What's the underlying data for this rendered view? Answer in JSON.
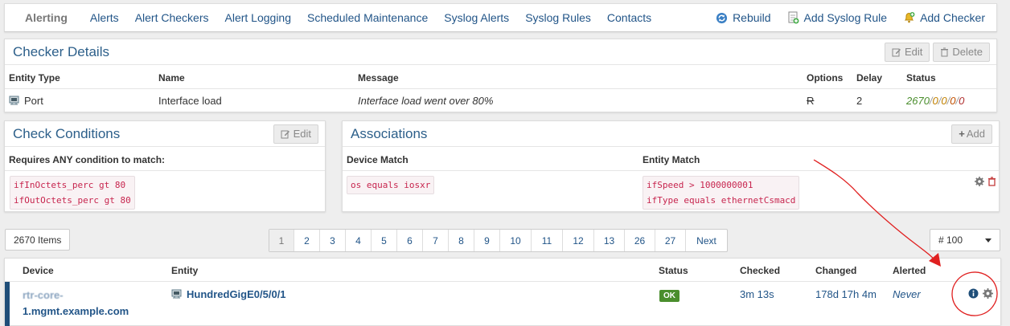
{
  "nav": {
    "brand": "Alerting",
    "links": [
      "Alerts",
      "Alert Checkers",
      "Alert Logging",
      "Scheduled Maintenance",
      "Syslog Alerts",
      "Syslog Rules",
      "Contacts"
    ],
    "actions": [
      "Rebuild",
      "Add Syslog Rule",
      "Add Checker"
    ]
  },
  "checker": {
    "title": "Checker Details",
    "edit_label": "Edit",
    "delete_label": "Delete",
    "headers": [
      "Entity Type",
      "Name",
      "Message",
      "Options",
      "Delay",
      "Status"
    ],
    "row": {
      "entity_type": "Port",
      "name": "Interface load",
      "message": "Interface load went over 80%",
      "options": "R",
      "delay": "2",
      "status_ok": "2670",
      "status_rest": [
        "0",
        "0",
        "0",
        "0"
      ]
    }
  },
  "conditions": {
    "title": "Check Conditions",
    "edit_label": "Edit",
    "requires_label": "Requires ANY condition to match:",
    "items": [
      "ifInOctets_perc gt 80",
      "ifOutOctets_perc gt 80"
    ]
  },
  "associations": {
    "title": "Associations",
    "add_label": "Add",
    "device_match_header": "Device Match",
    "entity_match_header": "Entity Match",
    "device_match": [
      "os equals iosxr"
    ],
    "entity_match": [
      "ifSpeed > 1000000001",
      "ifType equals ethernetCsmacd"
    ]
  },
  "pagination": {
    "items_label": "2670 Items",
    "pages": [
      "1",
      "2",
      "3",
      "4",
      "5",
      "6",
      "7",
      "8",
      "9",
      "10",
      "11",
      "12",
      "13",
      "26",
      "27",
      "Next"
    ],
    "active": "1",
    "per_page": "# 100"
  },
  "entities": {
    "headers": [
      "Device",
      "Entity",
      "Status",
      "Checked",
      "Changed",
      "Alerted"
    ],
    "row": {
      "device_line1": "rtr-core-",
      "device_line2": "1.mgmt.example.com",
      "entity": "HundredGigE0/5/0/1",
      "status": "OK",
      "checked": "3m 13s",
      "changed": "178d 17h 4m",
      "alerted": "Never"
    }
  },
  "colors": {
    "link": "#225588",
    "title": "#2c5f8a",
    "ok": "#4a8e2d",
    "code": "#c7254e",
    "annotation": "#e02020"
  }
}
